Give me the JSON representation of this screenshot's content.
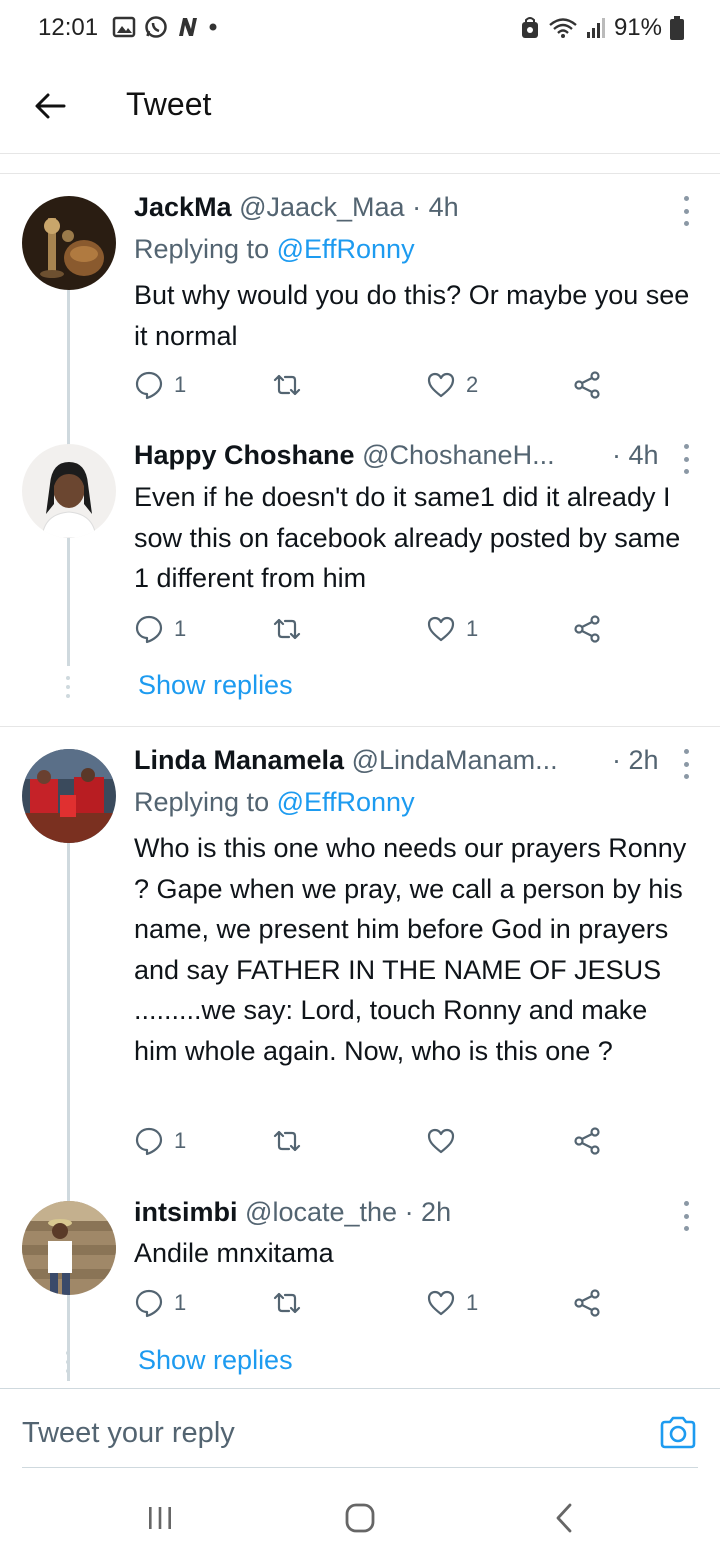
{
  "status_bar": {
    "time": "12:01",
    "battery": "91%",
    "icons": [
      "gallery-icon",
      "whatsapp-icon",
      "n-icon",
      "dot-icon",
      "lock-icon",
      "wifi-icon",
      "signal-icon",
      "battery-icon"
    ]
  },
  "header": {
    "title": "Tweet"
  },
  "tweets": [
    {
      "name": "JackMa",
      "handle": "@Jaack_Maa",
      "time": "· 4h",
      "replying_prefix": "Replying to ",
      "replying_to": "@EffRonny",
      "body": "But why would you do this? Or maybe you see it normal",
      "replies": "1",
      "retweets": "",
      "likes": "2"
    },
    {
      "name": "Happy Choshane",
      "handle": "@ChoshaneH...",
      "time": "· 4h",
      "body": "Even if he doesn't do it same1 did it already I sow this on facebook already posted by same 1 different from him",
      "replies": "1",
      "retweets": "",
      "likes": "1",
      "show_replies": "Show replies"
    },
    {
      "name": "Linda Manamela",
      "handle": "@LindaManam...",
      "time": "· 2h",
      "replying_prefix": "Replying to ",
      "replying_to": "@EffRonny",
      "body": "Who is this one who needs our prayers Ronny ? Gape when we pray, we call a person by his name, we present him before God in prayers and say FATHER IN THE NAME OF JESUS .........we say: Lord, touch Ronny and make him whole again. Now, who is this one ?",
      "replies": "1",
      "retweets": "",
      "likes": ""
    },
    {
      "name": "intsimbi",
      "handle": "@locate_the",
      "time": "· 2h",
      "body": "Andile mnxitama",
      "replies": "1",
      "retweets": "",
      "likes": "1",
      "show_replies": "Show replies"
    }
  ],
  "reply_bar": {
    "placeholder": "Tweet your reply"
  },
  "colors": {
    "link": "#1d9bf0",
    "secondary_text": "#536471",
    "primary_text": "#0f1419"
  }
}
